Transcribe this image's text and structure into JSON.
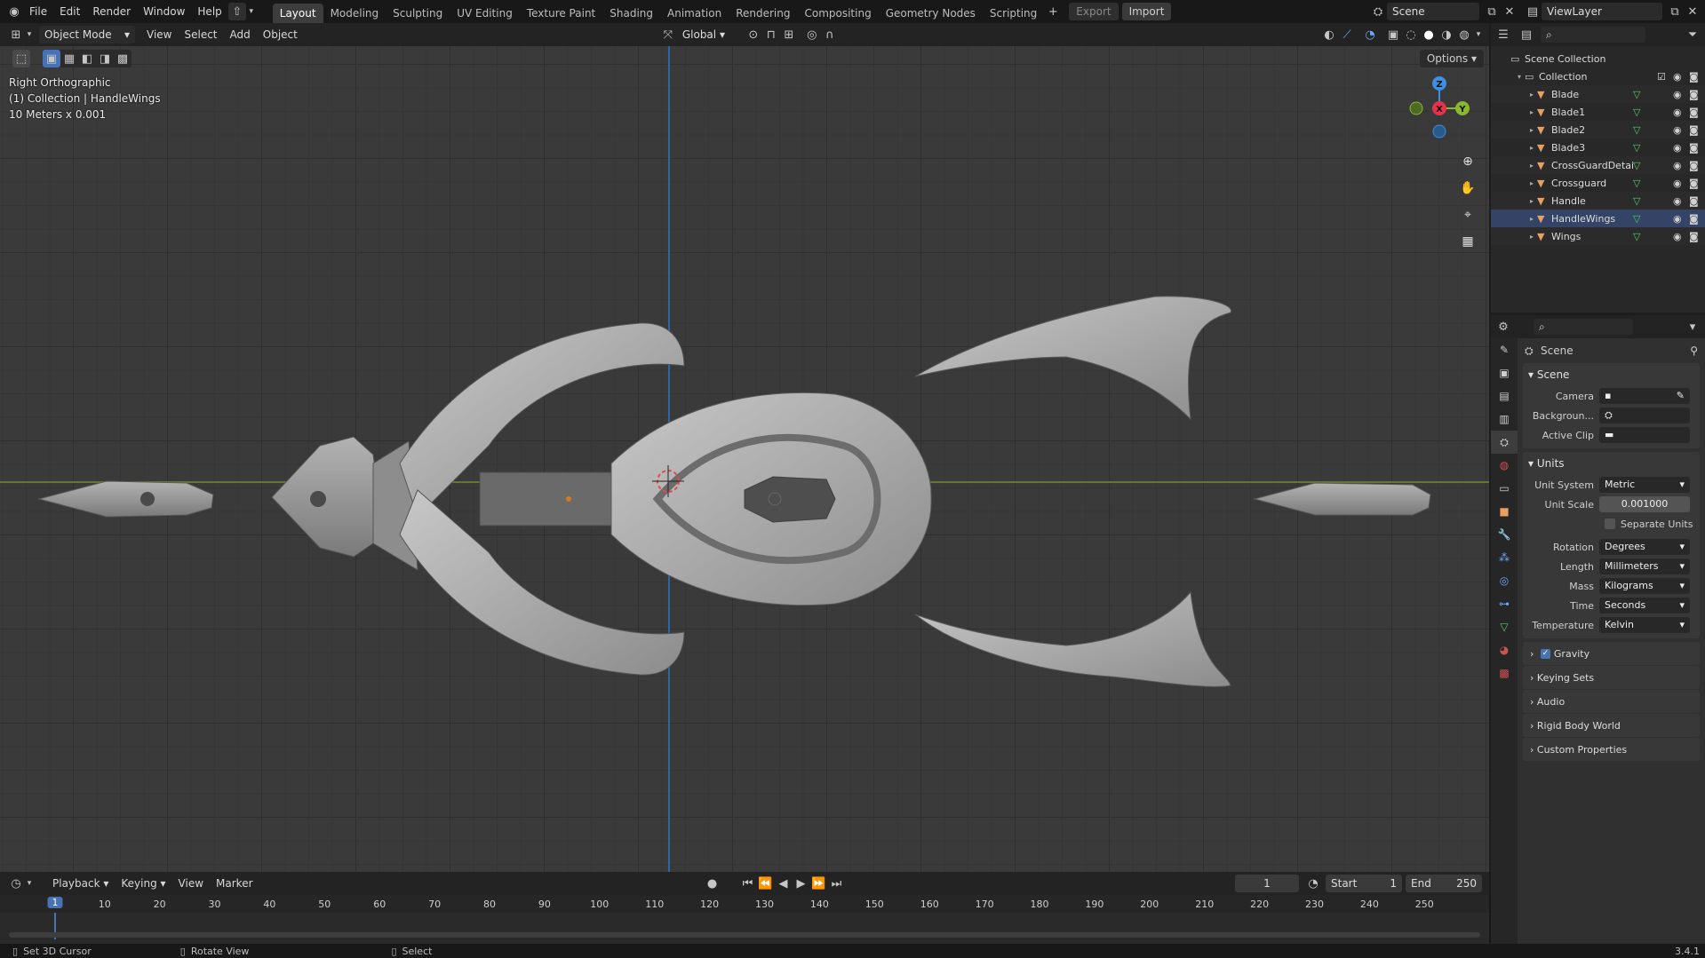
{
  "topbar": {
    "menus": [
      "File",
      "Edit",
      "Render",
      "Window",
      "Help"
    ],
    "workspaces": [
      "Layout",
      "Modeling",
      "Sculpting",
      "UV Editing",
      "Texture Paint",
      "Shading",
      "Animation",
      "Rendering",
      "Compositing",
      "Geometry Nodes",
      "Scripting"
    ],
    "active_workspace": "Layout",
    "export_label": "Export",
    "import_label": "Import",
    "scene_name": "Scene",
    "view_layer": "ViewLayer"
  },
  "viewport_header": {
    "mode": "Object Mode",
    "menus": [
      "View",
      "Select",
      "Add",
      "Object"
    ],
    "transform_orientation": "Global",
    "options_label": "Options"
  },
  "viewport": {
    "view_name": "Right Orthographic",
    "collection_info": "(1) Collection | HandleWings",
    "scale_info": "10 Meters x 0.001",
    "gizmo": {
      "z": "Z",
      "y": "Y",
      "x": "X"
    }
  },
  "outliner": {
    "root": "Scene Collection",
    "collection": "Collection",
    "items": [
      "Blade",
      "Blade1",
      "Blade2",
      "Blade3",
      "CrossGuardDetails",
      "Crossguard",
      "Handle",
      "HandleWings",
      "Wings"
    ]
  },
  "properties": {
    "context": "Scene",
    "scene_panel": {
      "title": "Scene",
      "camera_label": "Camera",
      "background_label": "Backgroun...",
      "active_clip_label": "Active Clip"
    },
    "units_panel": {
      "title": "Units",
      "unit_system_label": "Unit System",
      "unit_system": "Metric",
      "unit_scale_label": "Unit Scale",
      "unit_scale": "0.001000",
      "separate_units": "Separate Units",
      "rotation_label": "Rotation",
      "rotation": "Degrees",
      "length_label": "Length",
      "length": "Millimeters",
      "mass_label": "Mass",
      "mass": "Kilograms",
      "time_label": "Time",
      "time": "Seconds",
      "temperature_label": "Temperature",
      "temperature": "Kelvin"
    },
    "collapsed": [
      "Gravity",
      "Keying Sets",
      "Audio",
      "Rigid Body World",
      "Custom Properties"
    ]
  },
  "timeline": {
    "menus": [
      "Playback",
      "Keying",
      "View",
      "Marker"
    ],
    "current_frame": "1",
    "start_label": "Start",
    "start": "1",
    "end_label": "End",
    "end": "250",
    "ticks": [
      "1",
      "10",
      "20",
      "30",
      "40",
      "50",
      "60",
      "70",
      "80",
      "90",
      "100",
      "110",
      "120",
      "130",
      "140",
      "150",
      "160",
      "170",
      "180",
      "190",
      "200",
      "210",
      "220",
      "230",
      "240",
      "250"
    ]
  },
  "statusbar": {
    "left": "Set 3D Cursor",
    "middle": "Rotate View",
    "right": "Select",
    "version": "3.4.1"
  },
  "colors": {
    "accent": "#4772b3",
    "x_axis": "#e8324a",
    "y_axis": "#89b82b",
    "z_axis": "#3e8fe0"
  }
}
